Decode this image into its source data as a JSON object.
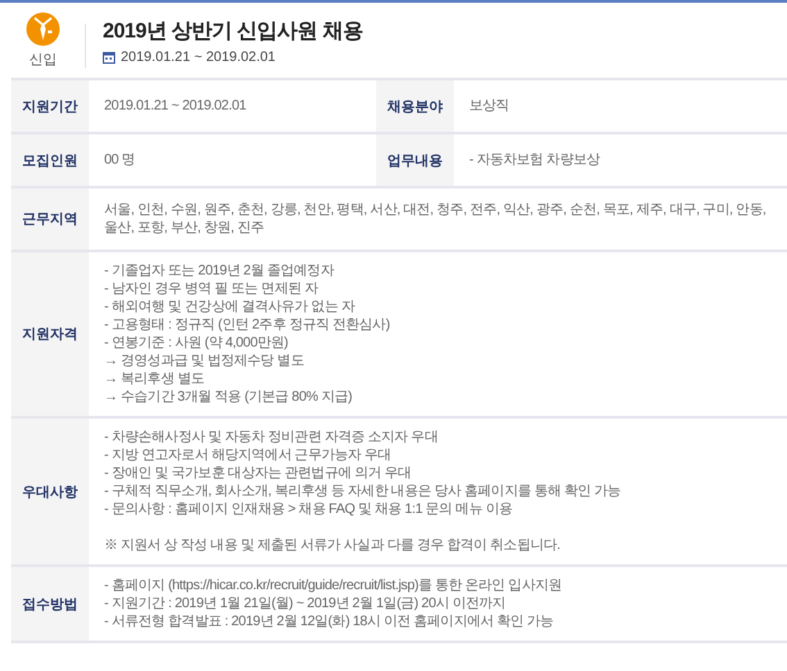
{
  "header": {
    "badge_label": "신입",
    "title": "2019년 상반기 신입사원 채용",
    "period": "2019.01.21 ~ 2019.02.01"
  },
  "rows": [
    {
      "kind": "pair",
      "cells": [
        {
          "label": "지원기간",
          "value": "2019.01.21 ~ 2019.02.01"
        },
        {
          "label": "채용분야",
          "value": "보상직"
        }
      ]
    },
    {
      "kind": "pair",
      "cells": [
        {
          "label": "모집인원",
          "value": "00 명"
        },
        {
          "label": "업무내용",
          "value": "- 자동차보험 차량보상"
        }
      ]
    },
    {
      "kind": "list",
      "label": "근무지역",
      "lines": [
        "서울, 인천, 수원, 원주, 춘천, 강릉, 천안, 평택, 서산, 대전, 청주, 전주, 익산, 광주, 순천, 목포, 제주, 대구, 구미, 안동, 울산, 포항, 부산, 창원, 진주"
      ]
    },
    {
      "kind": "list",
      "label": "지원자격",
      "lines": [
        "- 기졸업자 또는 2019년 2월 졸업예정자",
        "- 남자인 경우 병역 필 또는 면제된 자",
        "- 해외여행 및 건강상에 결격사유가 없는 자",
        "- 고용형태 : 정규직 (인턴 2주후 정규직 전환심사)",
        "- 연봉기준 : 사원 (약 4,000만원)",
        "→ 경영성과급 및 법정제수당 별도",
        "→ 복리후생 별도",
        "→ 수습기간 3개월 적용 (기본급 80% 지급)"
      ]
    },
    {
      "kind": "list",
      "label": "우대사항",
      "lines": [
        "- 차량손해사정사 및 자동차 정비관련 자격증 소지자 우대",
        "- 지방 연고자로서 해당지역에서 근무가능자 우대",
        "- 장애인 및 국가보훈 대상자는 관련법규에 의거 우대",
        "- 구체적 직무소개, 회사소개, 복리후생 등 자세한 내용은 당사 홈페이지를 통해 확인 가능",
        "- 문의사항 : 홈페이지 인재채용 > 채용 FAQ 및 채용 1:1 문의 메뉴 이용"
      ],
      "note": "※ 지원서 상 작성 내용 및 제출된 서류가 사실과 다를 경우 합격이 취소됩니다."
    },
    {
      "kind": "list",
      "label": "접수방법",
      "lines": [
        "- 홈페이지 (https://hicar.co.kr/recruit/guide/recruit/list.jsp)를 통한 온라인 입사지원",
        "- 지원기간 : 2019년 1월 21일(월) ~ 2019년 2월 1일(금) 20시 이전까지",
        "- 서류전형 합격발표 : 2019년 2월 12일(화) 18시 이전 홈페이지에서 확인 가능"
      ]
    }
  ]
}
